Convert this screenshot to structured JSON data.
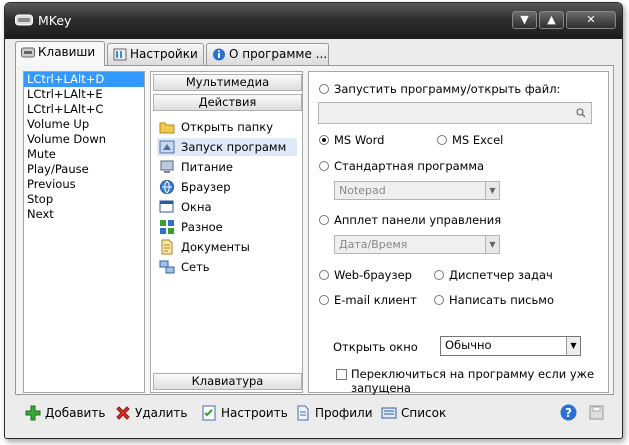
{
  "window": {
    "title": "MKey",
    "minimize": "▼",
    "maximize": "▲",
    "close": "✕"
  },
  "tabs": [
    {
      "label": "Клавиши"
    },
    {
      "label": "Настройки"
    },
    {
      "label": "О программе ..."
    }
  ],
  "keys": [
    "LCtrl+LAlt+D",
    "LCtrl+LAlt+E",
    "LCtrl+LAlt+C",
    "Volume Up",
    "Volume Down",
    "Mute",
    "Play/Pause",
    "Previous",
    "Stop",
    "Next"
  ],
  "categories": {
    "multimedia": "Мультимедиа",
    "actions": "Действия",
    "keyboard": "Клавиатура"
  },
  "actions": [
    "Открыть папку",
    "Запуск программ",
    "Питание",
    "Браузер",
    "Окна",
    "Разное",
    "Документы",
    "Сеть"
  ],
  "options": {
    "run_program": "Запустить программу/открыть файл:",
    "ms_word": "MS Word",
    "ms_excel": "MS Excel",
    "standard_program": "Стандартная программа",
    "standard_value": "Notepad",
    "applet": "Апплет панели управления",
    "applet_value": "Дата/Время",
    "web_browser": "Web-браузер",
    "task_manager": "Диспетчер задач",
    "email_client": "E-mail клиент",
    "write_letter": "Написать письмо",
    "open_window_label": "Открыть окно",
    "open_window_value": "Обычно",
    "switch_label_1": "Переключиться на программу если уже",
    "switch_label_2": "запущена"
  },
  "toolbar": {
    "add": "Добавить",
    "delete": "Удалить",
    "configure": "Настроить",
    "profiles": "Профили",
    "list": "Список"
  },
  "colors": {
    "selection": "#3399ff",
    "titlebar": "#1c1c1c"
  }
}
